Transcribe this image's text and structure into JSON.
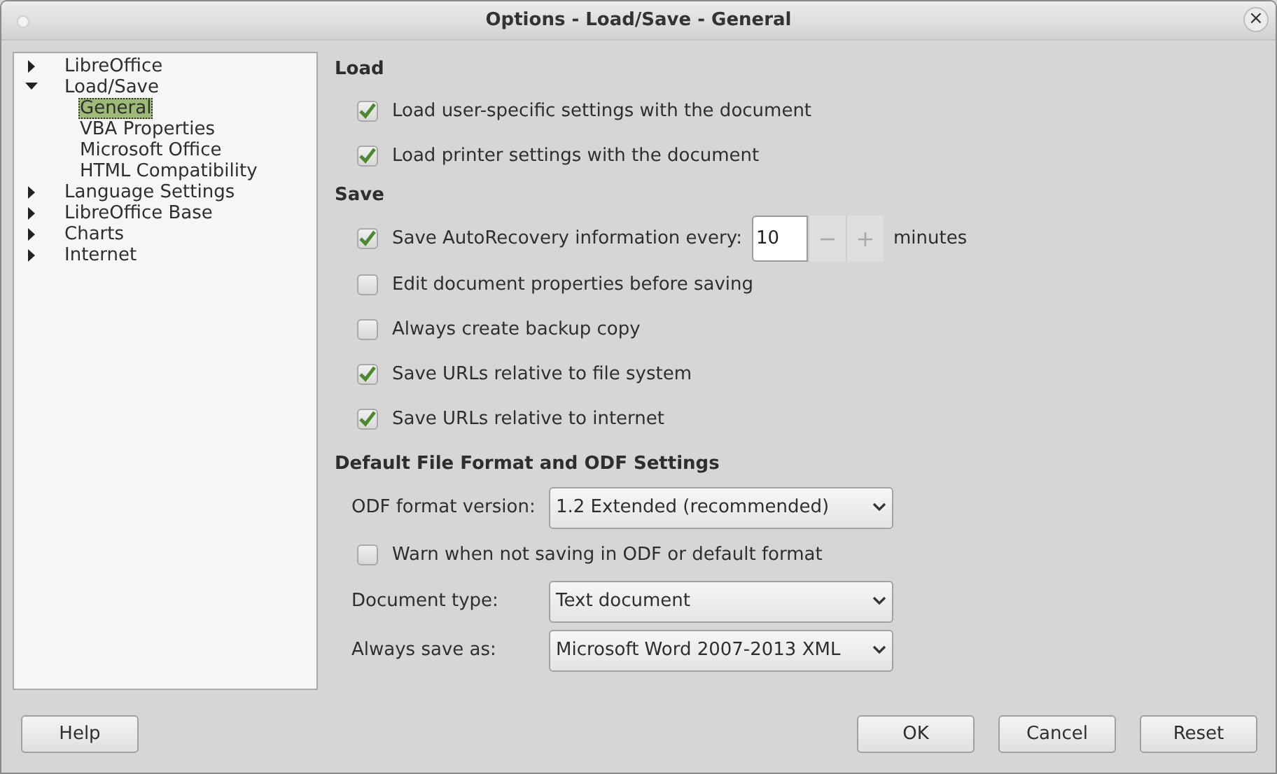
{
  "window": {
    "title": "Options - Load/Save - General",
    "close": "×"
  },
  "tree": [
    {
      "label": "LibreOffice",
      "expanded": false,
      "selected": false
    },
    {
      "label": "Load/Save",
      "expanded": true,
      "selected": false,
      "children": [
        {
          "label": "General",
          "selected": true
        },
        {
          "label": "VBA Properties",
          "selected": false
        },
        {
          "label": "Microsoft Office",
          "selected": false
        },
        {
          "label": "HTML Compatibility",
          "selected": false
        }
      ]
    },
    {
      "label": "Language Settings",
      "expanded": false,
      "selected": false
    },
    {
      "label": "LibreOffice Base",
      "expanded": false,
      "selected": false
    },
    {
      "label": "Charts",
      "expanded": false,
      "selected": false
    },
    {
      "label": "Internet",
      "expanded": false,
      "selected": false
    }
  ],
  "sections": [
    {
      "heading": "Load",
      "rows": [
        {
          "kind": "checkbox",
          "label": "Load user-specific settings with the document",
          "checked": true
        },
        {
          "kind": "checkbox",
          "label": "Load printer settings with the document",
          "checked": true
        }
      ]
    },
    {
      "heading": "Save",
      "rows": [
        {
          "kind": "spin",
          "label": "Save AutoRecovery information every:",
          "checked": true,
          "value": "10",
          "minus": "−",
          "plus": "+",
          "unit": "minutes"
        },
        {
          "kind": "checkbox",
          "label": "Edit document properties before saving",
          "checked": false
        },
        {
          "kind": "checkbox",
          "label": "Always create backup copy",
          "checked": false
        },
        {
          "kind": "checkbox",
          "label": "Save URLs relative to file system",
          "checked": true
        },
        {
          "kind": "checkbox",
          "label": "Save URLs relative to internet",
          "checked": true
        }
      ]
    },
    {
      "heading": "Default File Format and ODF Settings",
      "rows": [
        {
          "kind": "select",
          "label": "ODF format version:",
          "value": "1.2 Extended (recommended)"
        },
        {
          "kind": "checkbox",
          "label": "Warn when not saving in ODF or default format",
          "checked": false
        },
        {
          "kind": "select",
          "label": "Document type:",
          "value": "Text document"
        },
        {
          "kind": "select",
          "label": "Always save as:",
          "value": "Microsoft Word 2007-2013 XML"
        }
      ]
    }
  ],
  "help_button": "Help",
  "buttons": [
    "OK",
    "Cancel",
    "Reset"
  ]
}
